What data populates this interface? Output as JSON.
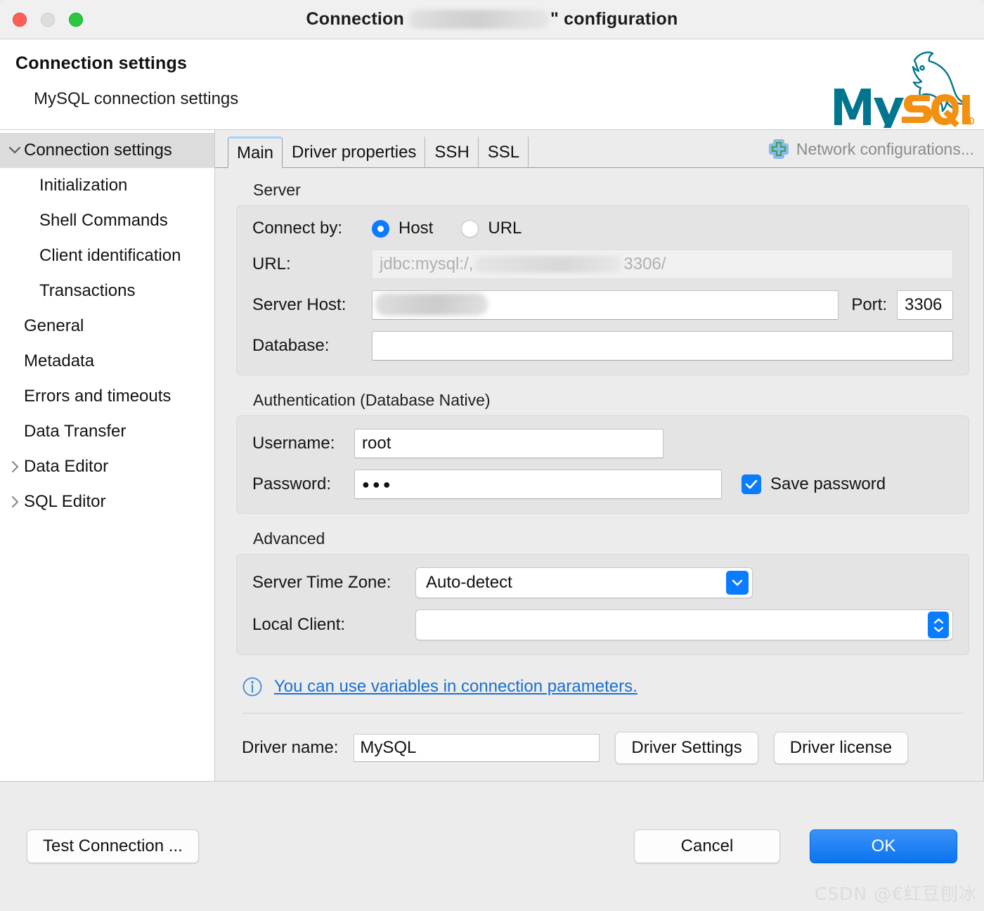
{
  "window": {
    "title_prefix": "Connection",
    "title_suffix": "\" configuration",
    "traffic_lights": [
      "close",
      "minimize",
      "zoom"
    ]
  },
  "header": {
    "heading": "Connection settings",
    "subheading": "MySQL connection settings",
    "logo_alt": "MySQL",
    "logo_word_1": "My",
    "logo_word_2": "SQL",
    "colors": {
      "teal": "#00758F",
      "orange": "#F29111"
    }
  },
  "sidebar": {
    "items": [
      {
        "label": "Connection settings",
        "level": 0,
        "expander": "chevron-down-icon",
        "selected": true
      },
      {
        "label": "Initialization",
        "level": 1,
        "expander": "",
        "selected": false
      },
      {
        "label": "Shell Commands",
        "level": 1,
        "expander": "",
        "selected": false
      },
      {
        "label": "Client identification",
        "level": 1,
        "expander": "",
        "selected": false
      },
      {
        "label": "Transactions",
        "level": 1,
        "expander": "",
        "selected": false
      },
      {
        "label": "General",
        "level": 0,
        "expander": "",
        "selected": false
      },
      {
        "label": "Metadata",
        "level": 0,
        "expander": "",
        "selected": false
      },
      {
        "label": "Errors and timeouts",
        "level": 0,
        "expander": "",
        "selected": false
      },
      {
        "label": "Data Transfer",
        "level": 0,
        "expander": "",
        "selected": false
      },
      {
        "label": "Data Editor",
        "level": 0,
        "expander": "chevron-right-icon",
        "selected": false
      },
      {
        "label": "SQL Editor",
        "level": 0,
        "expander": "chevron-right-icon",
        "selected": false
      }
    ]
  },
  "tabs": {
    "items": [
      {
        "label": "Main",
        "active": true
      },
      {
        "label": "Driver properties",
        "active": false
      },
      {
        "label": "SSH",
        "active": false
      },
      {
        "label": "SSL",
        "active": false
      }
    ],
    "network_link": "Network configurations...",
    "network_icon": "plus-icon"
  },
  "server": {
    "group_title": "Server",
    "connect_by_label": "Connect by:",
    "options": [
      {
        "label": "Host",
        "selected": true
      },
      {
        "label": "URL",
        "selected": false
      }
    ],
    "url_label": "URL:",
    "url_value_prefix": "jdbc:mysql:/,",
    "url_value_suffix": "3306/",
    "host_label": "Server Host:",
    "host_value": "",
    "port_label": "Port:",
    "port_value": "3306",
    "database_label": "Database:",
    "database_value": ""
  },
  "authentication": {
    "group_title": "Authentication (Database Native)",
    "username_label": "Username:",
    "username_value": "root",
    "password_label": "Password:",
    "password_value": "●●●",
    "save_password_label": "Save password",
    "save_password_checked": true
  },
  "advanced": {
    "group_title": "Advanced",
    "timezone_label": "Server Time Zone:",
    "timezone_value": "Auto-detect",
    "local_client_label": "Local Client:",
    "local_client_value": ""
  },
  "info": {
    "icon": "info-icon",
    "link_text": "You can use variables in connection parameters."
  },
  "driver": {
    "name_label": "Driver name:",
    "name_value": "MySQL",
    "settings_button": "Driver Settings",
    "license_button": "Driver license"
  },
  "footer": {
    "test_connection": "Test Connection ...",
    "cancel": "Cancel",
    "ok": "OK",
    "accent_color": "#0a74f0"
  },
  "watermark": "CSDN @€红豆刨冰"
}
